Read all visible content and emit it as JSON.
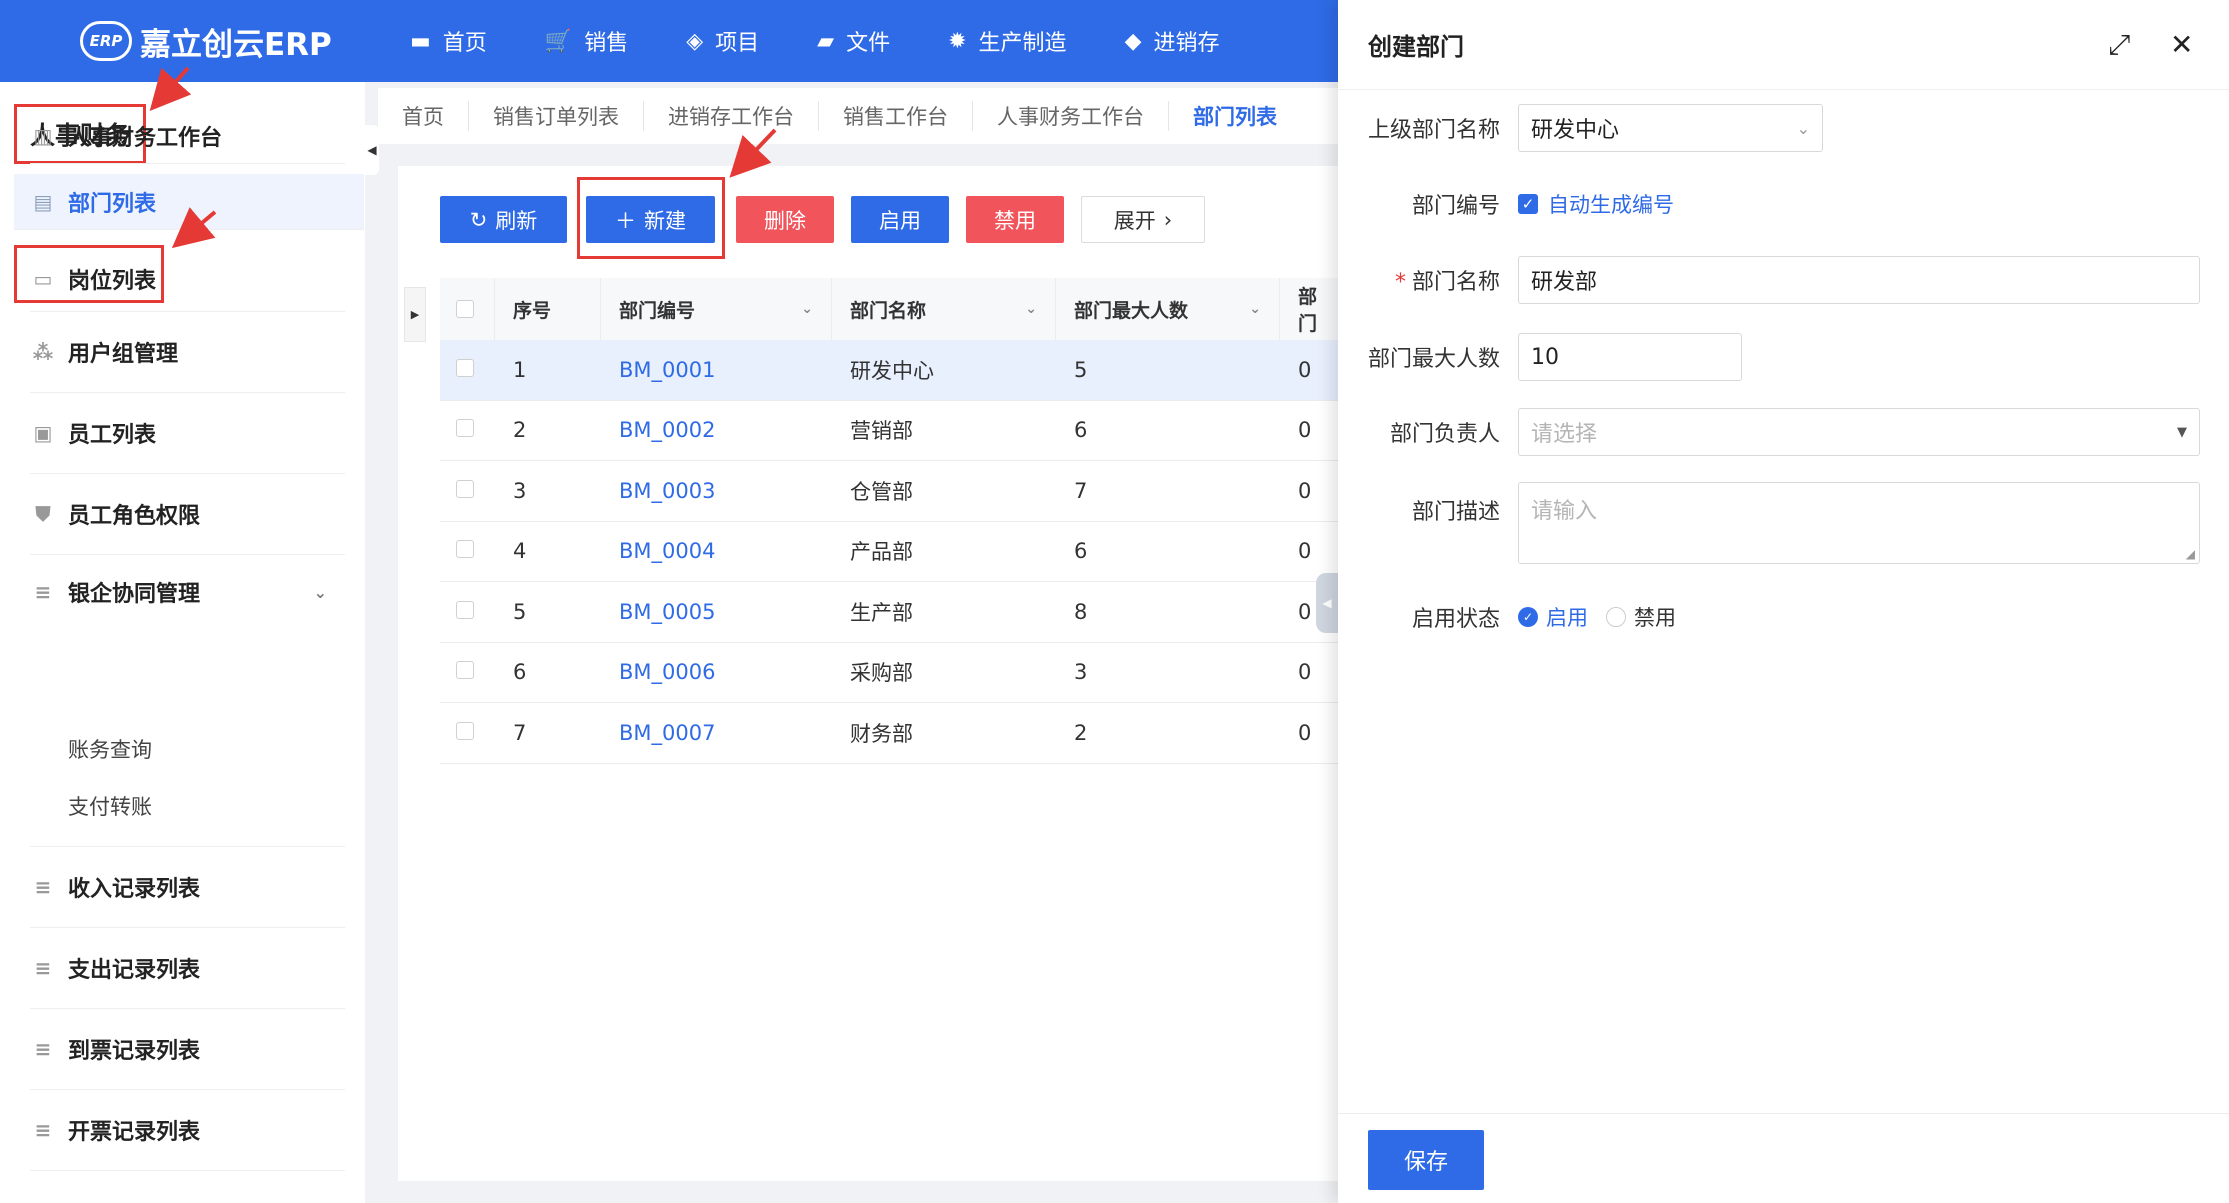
{
  "app": {
    "logo_mark": "ERP",
    "name": "嘉立创云ERP"
  },
  "topnav": [
    {
      "label": "首页",
      "icon": "monitor-icon"
    },
    {
      "label": "销售",
      "icon": "cart-icon"
    },
    {
      "label": "项目",
      "icon": "layers-icon"
    },
    {
      "label": "文件",
      "icon": "folder-icon"
    },
    {
      "label": "生产制造",
      "icon": "gear-icon"
    },
    {
      "label": "进销存",
      "icon": "box-icon"
    }
  ],
  "sidebar": {
    "title": "人事财务",
    "items": [
      {
        "label": "人事财务工作台"
      },
      {
        "label": "部门列表"
      },
      {
        "label": "岗位列表"
      },
      {
        "label": "用户组管理"
      },
      {
        "label": "员工列表"
      },
      {
        "label": "员工角色权限"
      },
      {
        "label": "银企协同管理"
      },
      {
        "label": "收入记录列表"
      },
      {
        "label": "支出记录列表"
      },
      {
        "label": "到票记录列表"
      },
      {
        "label": "开票记录列表"
      }
    ],
    "subitems": [
      "账务查询",
      "支付转账"
    ]
  },
  "tabs": [
    "首页",
    "销售订单列表",
    "进销存工作台",
    "销售工作台",
    "人事财务工作台",
    "部门列表"
  ],
  "toolbar": {
    "refresh": "刷新",
    "new": "新建",
    "delete": "删除",
    "enable": "启用",
    "disable": "禁用",
    "expand": "展开"
  },
  "table": {
    "headers": [
      "序号",
      "部门编号",
      "部门名称",
      "部门最大人数",
      "部门"
    ],
    "rows": [
      [
        "1",
        "BM_0001",
        "研发中心",
        "5",
        "0"
      ],
      [
        "2",
        "BM_0002",
        "营销部",
        "6",
        "0"
      ],
      [
        "3",
        "BM_0003",
        "仓管部",
        "7",
        "0"
      ],
      [
        "4",
        "BM_0004",
        "产品部",
        "6",
        "0"
      ],
      [
        "5",
        "BM_0005",
        "生产部",
        "8",
        "0"
      ],
      [
        "6",
        "BM_0006",
        "采购部",
        "3",
        "0"
      ],
      [
        "7",
        "BM_0007",
        "财务部",
        "2",
        "0"
      ]
    ]
  },
  "drawer": {
    "title": "创建部门",
    "fields": {
      "parent_label": "上级部门名称",
      "parent_value": "研发中心",
      "code_label": "部门编号",
      "code_auto": "自动生成编号",
      "name_label": "部门名称",
      "name_value": "研发部",
      "max_label": "部门最大人数",
      "max_value": "10",
      "leader_label": "部门负责人",
      "leader_placeholder": "请选择",
      "desc_label": "部门描述",
      "desc_placeholder": "请输入",
      "status_label": "启用状态",
      "status_on": "启用",
      "status_off": "禁用"
    },
    "save": "保存"
  },
  "colors": {
    "primary": "#2f6be6",
    "danger": "#f2545b",
    "highlight": "#e53935"
  }
}
